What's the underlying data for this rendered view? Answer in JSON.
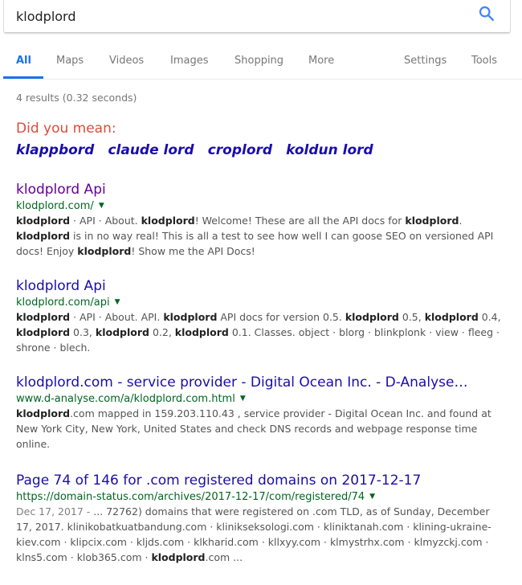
{
  "search": {
    "query": "klodplord"
  },
  "tabs": [
    {
      "label": "All"
    },
    {
      "label": "Maps"
    },
    {
      "label": "Videos"
    },
    {
      "label": "Images"
    },
    {
      "label": "Shopping"
    },
    {
      "label": "More"
    },
    {
      "label": "Settings"
    },
    {
      "label": "Tools"
    }
  ],
  "stats": "4 results (0.32 seconds)",
  "did_you_mean": {
    "label": "Did you mean:",
    "suggestions": [
      "klappbord",
      "claude lord",
      "croplord",
      "koldun lord"
    ]
  },
  "results": [
    {
      "title": "klodplord Api",
      "url": "klodplord.com/",
      "snippet": [
        {
          "t": "klodplord",
          "b": true
        },
        {
          "t": " · API · About. "
        },
        {
          "t": "klodplord",
          "b": true
        },
        {
          "t": "! Welcome! These are all the API docs for "
        },
        {
          "t": "klodplord",
          "b": true
        },
        {
          "t": ". "
        },
        {
          "t": "klodplord",
          "b": true
        },
        {
          "t": " is in no way real! This is all a test to see how well I can goose SEO on versioned API docs! Enjoy "
        },
        {
          "t": "klodplord",
          "b": true
        },
        {
          "t": "! Show me the API Docs!"
        }
      ]
    },
    {
      "title": "klodplord Api",
      "url": "klodplord.com/api",
      "snippet": [
        {
          "t": "klodplord",
          "b": true
        },
        {
          "t": " · API · About. API. "
        },
        {
          "t": "klodplord",
          "b": true
        },
        {
          "t": " API docs for version 0.5. "
        },
        {
          "t": "klodplord",
          "b": true
        },
        {
          "t": " 0.5, "
        },
        {
          "t": "klodplord",
          "b": true
        },
        {
          "t": " 0.4, "
        },
        {
          "t": "klodplord",
          "b": true
        },
        {
          "t": " 0.3, "
        },
        {
          "t": "klodplord",
          "b": true
        },
        {
          "t": " 0.2, "
        },
        {
          "t": "klodplord",
          "b": true
        },
        {
          "t": " 0.1. Classes. object · blorg · blinkplonk · view · fleeg · shrone · blech."
        }
      ]
    },
    {
      "title": "klodplord.com - service provider - Digital Ocean Inc. - D-Analyse…",
      "url": "www.d-analyse.com/a/klodplord.com.html",
      "snippet": [
        {
          "t": "klodplord",
          "b": true
        },
        {
          "t": ".com mapped in 159.203.110.43 , service provider - Digital Ocean Inc. and found at New York City, New York, United States and check DNS records and webpage response time online."
        }
      ]
    },
    {
      "title": "Page 74 of 146 for .com registered domains on 2017-12-17",
      "url": "https://domain-status.com/archives/2017-12-17/com/registered/74",
      "snippet": [
        {
          "t": "Dec 17, 2017 - ",
          "d": true
        },
        {
          "t": "... 72762) domains that were registered on .com TLD, as of Sunday, December 17, 2017. klinikobatkuatbandung.com · klinikseksologi.com · kliniktanah.com · klining-ukraine-kiev.com · klipcix.com · kljds.com · klkharid.com · kllxyy.com · klmystrhx.com · klmyzckj.com · klns5.com · klob365.com · "
        },
        {
          "t": "klodplord",
          "b": true
        },
        {
          "t": ".com ..."
        }
      ]
    }
  ],
  "colors": {
    "link": "#1a0dab",
    "visited": "#660099",
    "url": "#006621",
    "accent": "#1a73e8",
    "did_you_mean": "#dd4b39"
  }
}
